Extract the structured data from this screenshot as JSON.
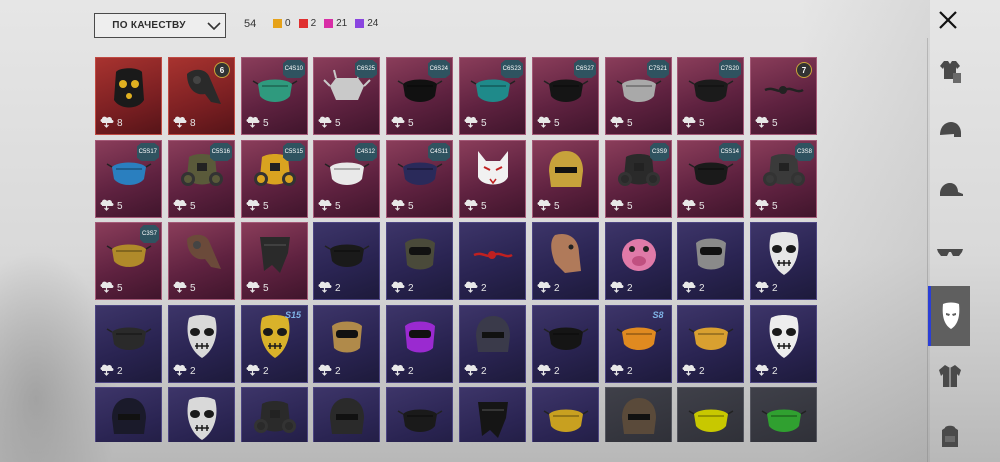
{
  "sort": {
    "label": "ПО КАЧЕСТВУ"
  },
  "total_count": "54",
  "rarity_counts": [
    {
      "value": "0",
      "color": "#e6a219"
    },
    {
      "value": "2",
      "color": "#e02f2f"
    },
    {
      "value": "21",
      "color": "#d82ea6"
    },
    {
      "value": "24",
      "color": "#8a45e0"
    }
  ],
  "sidebar": [
    {
      "icon": "outfit-icon"
    },
    {
      "icon": "helmet-icon"
    },
    {
      "icon": "cap-icon"
    },
    {
      "icon": "glasses-icon"
    },
    {
      "icon": "mask-icon",
      "active": true
    },
    {
      "icon": "jacket-icon"
    },
    {
      "icon": "backpack-icon"
    }
  ],
  "items": [
    {
      "rarity": "red",
      "count": "8",
      "badge": "",
      "badge_type": "",
      "mask": "robot-mask",
      "color": "#1a1a1a"
    },
    {
      "rarity": "red",
      "count": "8",
      "badge": "6",
      "badge_type": "round",
      "mask": "plague-mask",
      "color": "#2a2a2a"
    },
    {
      "rarity": "pink",
      "count": "5",
      "badge": "C4S10",
      "badge_type": "hex",
      "mask": "half-mask",
      "color": "#2f9a7e"
    },
    {
      "rarity": "pink",
      "count": "5",
      "badge": "C6S25",
      "badge_type": "hex",
      "mask": "spike-mask",
      "color": "#c9c9c9"
    },
    {
      "rarity": "pink",
      "count": "5",
      "badge": "C6S24",
      "badge_type": "hex",
      "mask": "half-mask",
      "color": "#111111"
    },
    {
      "rarity": "pink",
      "count": "5",
      "badge": "C6S23",
      "badge_type": "hex",
      "mask": "half-mask",
      "color": "#1f8a8a"
    },
    {
      "rarity": "pink",
      "count": "5",
      "badge": "C6S27",
      "badge_type": "hex",
      "mask": "half-mask",
      "color": "#151515"
    },
    {
      "rarity": "pink",
      "count": "5",
      "badge": "C7S21",
      "badge_type": "hex",
      "mask": "half-mask",
      "color": "#a9a9a9"
    },
    {
      "rarity": "pink",
      "count": "5",
      "badge": "C7S20",
      "badge_type": "hex",
      "mask": "half-mask",
      "color": "#1b1b1b"
    },
    {
      "rarity": "pink",
      "count": "5",
      "badge": "7",
      "badge_type": "round",
      "mask": "wire-mask",
      "color": "#222222"
    },
    {
      "rarity": "pink",
      "count": "5",
      "badge": "C5S17",
      "badge_type": "hex",
      "mask": "half-mask",
      "color": "#2a7fbf"
    },
    {
      "rarity": "pink",
      "count": "5",
      "badge": "C5S16",
      "badge_type": "hex",
      "mask": "gas-mask",
      "color": "#5a5a3a"
    },
    {
      "rarity": "pink",
      "count": "5",
      "badge": "C5S15",
      "badge_type": "hex",
      "mask": "gas-mask",
      "color": "#d9a320"
    },
    {
      "rarity": "pink",
      "count": "5",
      "badge": "C4S12",
      "badge_type": "hex",
      "mask": "half-mask",
      "color": "#e9e9e9"
    },
    {
      "rarity": "pink",
      "count": "5",
      "badge": "C4S11",
      "badge_type": "hex",
      "mask": "half-mask",
      "color": "#2a2a5a"
    },
    {
      "rarity": "pink",
      "count": "5",
      "badge": "",
      "badge_type": "",
      "mask": "fox-mask",
      "color": "#f1f1f1"
    },
    {
      "rarity": "pink",
      "count": "5",
      "badge": "",
      "badge_type": "",
      "mask": "helmet-mask",
      "color": "#c7a23b"
    },
    {
      "rarity": "pink",
      "count": "5",
      "badge": "C3S9",
      "badge_type": "hex",
      "mask": "gas-mask",
      "color": "#2a2a2a"
    },
    {
      "rarity": "pink",
      "count": "5",
      "badge": "C5S14",
      "badge_type": "hex",
      "mask": "half-mask",
      "color": "#1a1a1a"
    },
    {
      "rarity": "pink",
      "count": "5",
      "badge": "C3S8",
      "badge_type": "hex",
      "mask": "gas-mask",
      "color": "#3a3a3a"
    },
    {
      "rarity": "pink",
      "count": "5",
      "badge": "C3S7",
      "badge_type": "hex",
      "mask": "half-mask",
      "color": "#b08a2a"
    },
    {
      "rarity": "pink",
      "count": "5",
      "badge": "",
      "badge_type": "",
      "mask": "plague-mask",
      "color": "#6b4a3a"
    },
    {
      "rarity": "pink",
      "count": "5",
      "badge": "",
      "badge_type": "",
      "mask": "bandana-mask",
      "color": "#2a2a2a"
    },
    {
      "rarity": "purple",
      "count": "2",
      "badge": "",
      "badge_type": "",
      "mask": "half-mask",
      "color": "#1a1a1a"
    },
    {
      "rarity": "purple",
      "count": "2",
      "badge": "",
      "badge_type": "",
      "mask": "visor-mask",
      "color": "#4a4a3a"
    },
    {
      "rarity": "purple",
      "count": "2",
      "badge": "",
      "badge_type": "",
      "mask": "wire-mask",
      "color": "#c02020"
    },
    {
      "rarity": "purple",
      "count": "2",
      "badge": "",
      "badge_type": "",
      "mask": "horse-mask",
      "color": "#b07a5a"
    },
    {
      "rarity": "purple",
      "count": "2",
      "badge": "",
      "badge_type": "",
      "mask": "pig-mask",
      "color": "#e07aa8"
    },
    {
      "rarity": "purple",
      "count": "2",
      "badge": "",
      "badge_type": "",
      "mask": "visor-mask",
      "color": "#8a8a8a"
    },
    {
      "rarity": "purple",
      "count": "2",
      "badge": "",
      "badge_type": "",
      "mask": "skull-mask",
      "color": "#e6e6e6"
    },
    {
      "rarity": "purple",
      "count": "2",
      "badge": "",
      "badge_type": "",
      "mask": "half-mask",
      "color": "#2a2a2a"
    },
    {
      "rarity": "purple",
      "count": "2",
      "badge": "",
      "badge_type": "",
      "mask": "skull-mask",
      "color": "#d9d9d9"
    },
    {
      "rarity": "purple",
      "count": "2",
      "badge": "S15",
      "badge_type": "season",
      "mask": "skull-mask",
      "color": "#d9b22a"
    },
    {
      "rarity": "purple",
      "count": "2",
      "badge": "",
      "badge_type": "",
      "mask": "visor-mask",
      "color": "#b08a4a"
    },
    {
      "rarity": "purple",
      "count": "2",
      "badge": "",
      "badge_type": "",
      "mask": "visor-mask",
      "color": "#9a2ad0"
    },
    {
      "rarity": "purple",
      "count": "2",
      "badge": "",
      "badge_type": "",
      "mask": "helmet-mask",
      "color": "#3a3a4a"
    },
    {
      "rarity": "purple",
      "count": "2",
      "badge": "",
      "badge_type": "",
      "mask": "half-mask",
      "color": "#151515"
    },
    {
      "rarity": "purple",
      "count": "2",
      "badge": "S8",
      "badge_type": "season",
      "mask": "half-mask",
      "color": "#e08a20"
    },
    {
      "rarity": "purple",
      "count": "2",
      "badge": "",
      "badge_type": "",
      "mask": "half-mask",
      "color": "#d9a030"
    },
    {
      "rarity": "purple",
      "count": "2",
      "badge": "",
      "badge_type": "",
      "mask": "skull-mask",
      "color": "#ededed"
    },
    {
      "rarity": "purple",
      "count": "",
      "badge": "",
      "badge_type": "",
      "mask": "helmet-mask",
      "color": "#1a1a2a"
    },
    {
      "rarity": "purple",
      "count": "",
      "badge": "",
      "badge_type": "",
      "mask": "skull-mask",
      "color": "#d9d9d9"
    },
    {
      "rarity": "purple",
      "count": "",
      "badge": "",
      "badge_type": "",
      "mask": "gas-mask",
      "color": "#2a2a2a"
    },
    {
      "rarity": "purple",
      "count": "",
      "badge": "",
      "badge_type": "",
      "mask": "helmet-mask",
      "color": "#2a2a2a"
    },
    {
      "rarity": "purple",
      "count": "",
      "badge": "",
      "badge_type": "",
      "mask": "half-mask",
      "color": "#1a1a1a"
    },
    {
      "rarity": "purple",
      "count": "",
      "badge": "",
      "badge_type": "",
      "mask": "bandana-mask",
      "color": "#151515"
    },
    {
      "rarity": "purple",
      "count": "",
      "badge": "",
      "badge_type": "",
      "mask": "half-mask",
      "color": "#c8a020"
    },
    {
      "rarity": "dark",
      "count": "",
      "badge": "",
      "badge_type": "",
      "mask": "helmet-mask",
      "color": "#5a4a3a"
    },
    {
      "rarity": "dark",
      "count": "",
      "badge": "",
      "badge_type": "",
      "mask": "half-mask",
      "color": "#c8c800"
    },
    {
      "rarity": "dark",
      "count": "",
      "badge": "",
      "badge_type": "",
      "mask": "half-mask",
      "color": "#30a030"
    }
  ]
}
